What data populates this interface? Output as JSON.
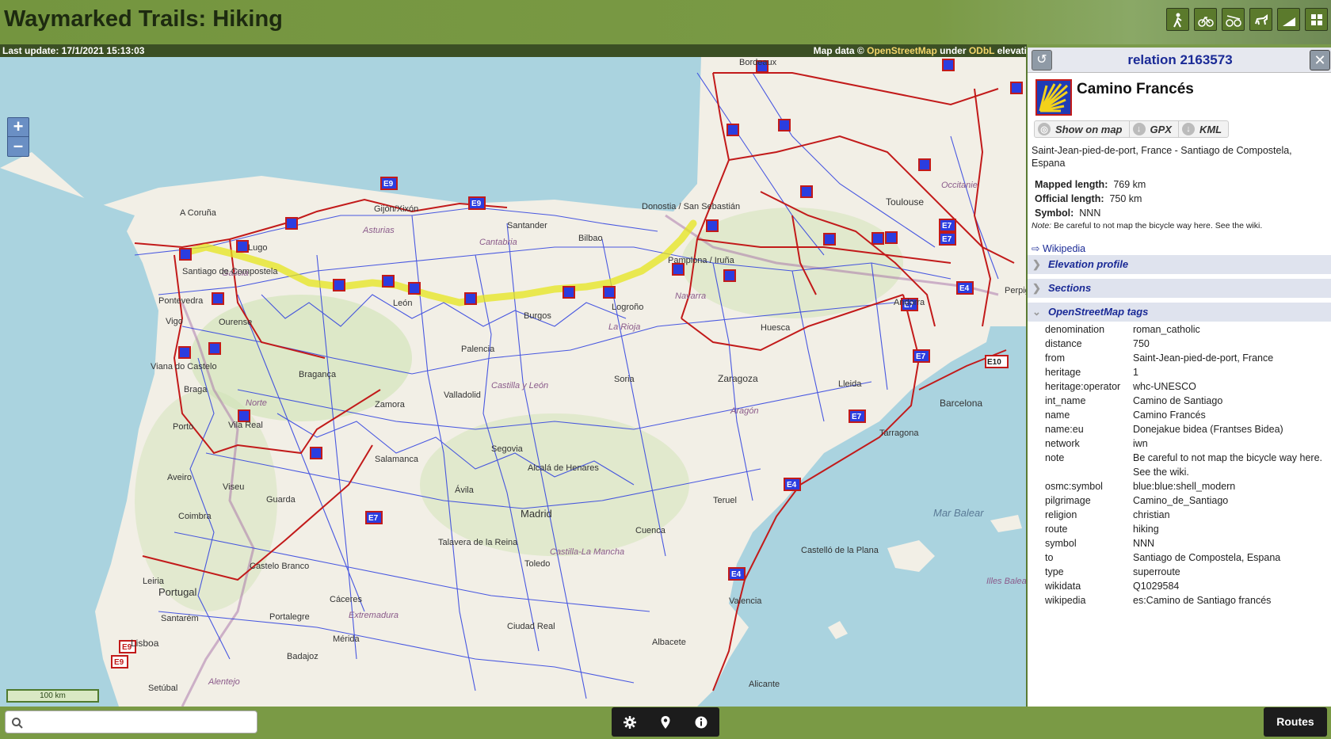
{
  "header": {
    "title": "Waymarked Trails: Hiking",
    "theme_icons": [
      "hiking-icon",
      "cycling-icon",
      "mtb-icon",
      "riding-icon",
      "slopes-icon",
      "skating-icon"
    ]
  },
  "statusbar": {
    "last_update": "Last update: 17/1/2021 15:13:03",
    "attr_prefix": "Map data ©",
    "attr_osm": "OpenStreetMap",
    "attr_under": "under",
    "attr_odbl": "ODbL",
    "attr_suffix": "elevati"
  },
  "map": {
    "zoom_in": "+",
    "zoom_out": "–",
    "scale_label": "100 km",
    "place_labels": [
      "Bordeaux",
      "Donostia / San Sebastián",
      "Toulouse",
      "Occitanie",
      "A Coruña",
      "Gijón/Xixón",
      "Lugo",
      "Galicia",
      "Santiago de Compostela",
      "Pontevedra",
      "Ourense",
      "Vigo",
      "Viana do Castelo",
      "Braga",
      "Bragança",
      "Norte",
      "Vila Real",
      "Porto",
      "Aveiro",
      "Viseu",
      "Guarda",
      "Coimbra",
      "Castelo Branco",
      "Portugal",
      "Leiria",
      "Lisboa",
      "Setúbal",
      "Alentejo",
      "Santarém",
      "Portalegre",
      "Mérida",
      "Badajoz",
      "Extremadura",
      "Cáceres",
      "Salamanca",
      "Zamora",
      "Valladolid",
      "Castilla y León",
      "Palencia",
      "Burgos",
      "La Rioja",
      "Logroño",
      "Pamplona / Iruña",
      "Navarra",
      "Bilbao",
      "Santander",
      "Cantabria",
      "Asturias",
      "León",
      "Soria",
      "Segovia",
      "Ávila",
      "Alcalá de Henares",
      "Madrid",
      "Talavera de la Reina",
      "Toledo",
      "Castilla-La Mancha",
      "Ciudad Real",
      "Cuenca",
      "Teruel",
      "Aragón",
      "Zaragoza",
      "Huesca",
      "Lleida",
      "Andorra",
      "Barcelona",
      "Tarragona",
      "Perpignan",
      "Mar Balear",
      "Castelló de la Plana",
      "Valencia",
      "Albacete",
      "Alicante",
      "Illes Balears"
    ],
    "trail_badges": [
      "E9",
      "E9",
      "E7",
      "E7",
      "E7",
      "E7",
      "E7",
      "E4",
      "E4",
      "E4",
      "E10",
      "E9",
      "E9",
      "E7"
    ]
  },
  "panel": {
    "title": "relation 2163573",
    "route_name": "Camino Francés",
    "actions": [
      {
        "label": "Show on map",
        "icon": "target-icon"
      },
      {
        "label": "GPX",
        "icon": "download-icon"
      },
      {
        "label": "KML",
        "icon": "download-icon"
      }
    ],
    "description": "Saint-Jean-pied-de-port, France - Santiago de Compostela, Espana",
    "stats": {
      "mapped_label": "Mapped length:",
      "mapped_value": "769 km",
      "official_label": "Official length:",
      "official_value": "750 km",
      "symbol_label": "Symbol:",
      "symbol_value": "NNN"
    },
    "note_label": "Note:",
    "note_text": "Be careful to not map the bicycle way here. See the wiki.",
    "wiki_link": "⇨ Wikipedia",
    "sections": [
      "Elevation profile",
      "Sections",
      "OpenStreetMap tags"
    ],
    "tags": [
      {
        "k": "denomination",
        "v": "roman_catholic"
      },
      {
        "k": "distance",
        "v": "750"
      },
      {
        "k": "from",
        "v": "Saint-Jean-pied-de-port, France"
      },
      {
        "k": "heritage",
        "v": "1"
      },
      {
        "k": "heritage:operator",
        "v": "whc-UNESCO"
      },
      {
        "k": "int_name",
        "v": "Camino de Santiago"
      },
      {
        "k": "name",
        "v": "Camino Francés"
      },
      {
        "k": "name:eu",
        "v": "Donejakue bidea (Frantses Bidea)"
      },
      {
        "k": "network",
        "v": "iwn"
      },
      {
        "k": "note",
        "v": "Be careful to not map the bicycle way here. See the wiki."
      },
      {
        "k": "osmc:symbol",
        "v": "blue:blue:shell_modern"
      },
      {
        "k": "pilgrimage",
        "v": "Camino_de_Santiago"
      },
      {
        "k": "religion",
        "v": "christian"
      },
      {
        "k": "route",
        "v": "hiking"
      },
      {
        "k": "symbol",
        "v": "NNN"
      },
      {
        "k": "to",
        "v": "Santiago de Compostela, Espana"
      },
      {
        "k": "type",
        "v": "superroute"
      },
      {
        "k": "wikidata",
        "v": "Q1029584"
      },
      {
        "k": "wikipedia",
        "v": "es:Camino de Santiago francés"
      }
    ]
  },
  "bottombar": {
    "search_placeholder": "",
    "tools": [
      "settings-icon",
      "location-pin-icon",
      "info-icon"
    ],
    "routes_label": "Routes"
  },
  "colors": {
    "header_green": "#7a9a45",
    "status_dark": "#3b4f24",
    "link_blue": "#1a2a96",
    "route_red": "#c21a1a",
    "route_blue": "#2b3de0",
    "highlight_yellow": "#e6e61c",
    "sea": "#aad3df",
    "land": "#f2efe6"
  }
}
